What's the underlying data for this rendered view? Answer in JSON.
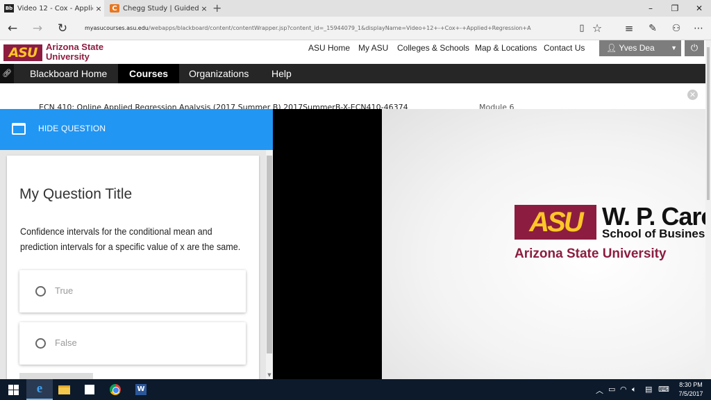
{
  "browser": {
    "tabs": [
      {
        "favicon": "Bb",
        "title": "Video 12 - Cox - Appliec",
        "active": true
      },
      {
        "favicon": "C",
        "title": "Chegg Study | Guided Soluti",
        "active": false
      }
    ],
    "new_tab": "+",
    "tab_close": "×",
    "window_controls": {
      "minimize": "–",
      "restore": "❐",
      "close": "✕"
    },
    "url_host": "myasucourses.asu.edu",
    "url_path": "/webapps/blackboard/content/contentWrapper.jsp?content_id=_15944079_1&displayName=Video+12+-+Cox+-+Applied+Regression+A"
  },
  "site": {
    "logo": "ASU",
    "name_line1": "Arizona State",
    "name_line2": "University",
    "top_links": [
      "ASU Home",
      "My ASU",
      "Colleges & Schools",
      "Map & Locations",
      "Contact Us"
    ],
    "user_name": "Yves Dea"
  },
  "bb_nav": {
    "tabs": [
      "Blackboard Home",
      "Courses",
      "Organizations",
      "Help"
    ],
    "active": "Courses"
  },
  "breadcrumb": {
    "course": "ECN 410: Online Applied Regression Analysis (2017 Summer B) 2017SummerB-X-ECN410-46374",
    "module": "Module 6"
  },
  "question_panel": {
    "hide_label": "HIDE QUESTION",
    "title": "My Question Title",
    "text": "Confidence intervals for the conditional mean and prediction intervals for a specific value of x are the same.",
    "options": [
      "True",
      "False"
    ]
  },
  "slide": {
    "logo": "ASU",
    "line1": "W. P. Carey",
    "line2": "School of Business",
    "line3": "Arizona State University"
  },
  "taskbar": {
    "time": "8:30 PM",
    "date": "7/5/2017"
  }
}
